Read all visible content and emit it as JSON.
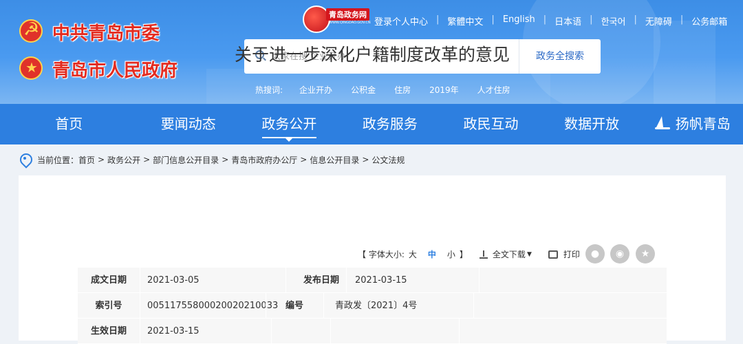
{
  "header": {
    "party_title": "中共青岛市委",
    "gov_title": "青岛市人民政府",
    "site_logo_text": "青岛政务网",
    "site_logo_sub": "WWW.QINGDAO.GOV.CN"
  },
  "top_links": [
    "登录个人中心",
    "繁體中文",
    "English",
    "日本语",
    "한국어",
    "无障碍",
    "公务邮箱"
  ],
  "search": {
    "placeholder": "大家在搜 企业开办",
    "button_label": "政务全搜索"
  },
  "hot_search": {
    "label": "热搜词:",
    "items": [
      "企业开办",
      "公积金",
      "住房",
      "2019年",
      "人才住房"
    ]
  },
  "nav": {
    "items": [
      "首页",
      "要闻动态",
      "政务公开",
      "政务服务",
      "政民互动",
      "数据开放",
      "扬帆青岛"
    ],
    "active_index": 2
  },
  "breadcrumb": {
    "label": "当前位置：",
    "items": [
      "首页",
      "政务公开",
      "部门信息公开目录",
      "青岛市政府办公厅",
      "信息公开目录",
      "公文法规"
    ]
  },
  "document": {
    "title": "关于进一步深化户籍制度改革的意见"
  },
  "tools": {
    "font_size_prefix": "【 字体大小:",
    "font_sizes": [
      "大",
      "中",
      "小"
    ],
    "font_size_suffix": "】",
    "download_label": "全文下载",
    "print_label": "打印"
  },
  "share_icons": [
    "wechat-icon",
    "weibo-icon",
    "favorite-icon"
  ],
  "meta": {
    "rows": [
      {
        "l1": "成文日期",
        "v1": "2021-03-05",
        "l2": "发布日期",
        "v2": "2021-03-15"
      },
      {
        "l1": "索引号",
        "v1": "00511755800020020210033",
        "l2": "编号",
        "v2": "青政发〔2021〕4号"
      },
      {
        "l1": "生效日期",
        "v1": "2021-03-15",
        "l2": "",
        "v2": ""
      }
    ]
  },
  "colors": {
    "header_blue": "#4a9af0",
    "nav_blue": "#2d7fe0",
    "title_red": "#e32b20"
  }
}
